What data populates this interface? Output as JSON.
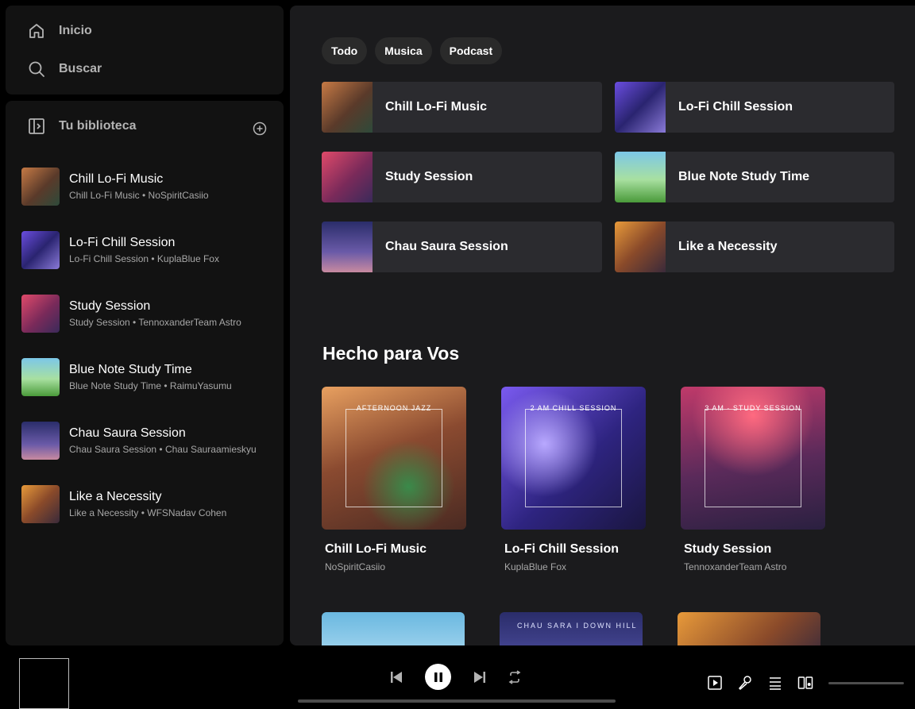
{
  "nav": {
    "home": "Inicio",
    "search": "Buscar"
  },
  "library": {
    "title": "Tu biblioteca",
    "items": [
      {
        "title": "Chill Lo-Fi Music",
        "subtitle": "Chill Lo-Fi Music • NoSpiritCasiio"
      },
      {
        "title": "Lo-Fi Chill Session",
        "subtitle": "Lo-Fi Chill Session • KuplaBlue Fox"
      },
      {
        "title": "Study Session",
        "subtitle": "Study Session • TennoxanderTeam Astro"
      },
      {
        "title": "Blue Note Study Time",
        "subtitle": "Blue Note Study Time • RaimuYasumu"
      },
      {
        "title": "Chau Saura Session",
        "subtitle": "Chau Saura Session • Chau Sauraamieskyu"
      },
      {
        "title": "Like a Necessity",
        "subtitle": "Like a Necessity • WFSNadav Cohen"
      }
    ]
  },
  "filters": [
    "Todo",
    "Musica",
    "Podcast"
  ],
  "quick": [
    "Chill Lo-Fi Music",
    "Lo-Fi Chill Session",
    "Study Session",
    "Blue Note Study Time",
    "Chau Saura Session",
    "Like a Necessity"
  ],
  "made_for_you": {
    "title": "Hecho para Vos",
    "cards": [
      {
        "name": "Chill Lo-Fi Music",
        "artists": "NoSpiritCasiio",
        "art_text": "AFTERNOON JAZZ"
      },
      {
        "name": "Lo-Fi Chill Session",
        "artists": "KuplaBlue Fox",
        "art_text": "2 AM CHILL SESSION"
      },
      {
        "name": "Study Session",
        "artists": "TennoxanderTeam Astro",
        "art_text": "3 AM · STUDY SESSION"
      }
    ],
    "next_row_art_texts": [
      "",
      "CHAU SARA  I DOWN HILL",
      ""
    ]
  },
  "colors": {
    "accent": "#ffffff",
    "panel": "#121212",
    "main_bg": "#1b1b1d",
    "tile_bg": "#2b2b2f"
  }
}
